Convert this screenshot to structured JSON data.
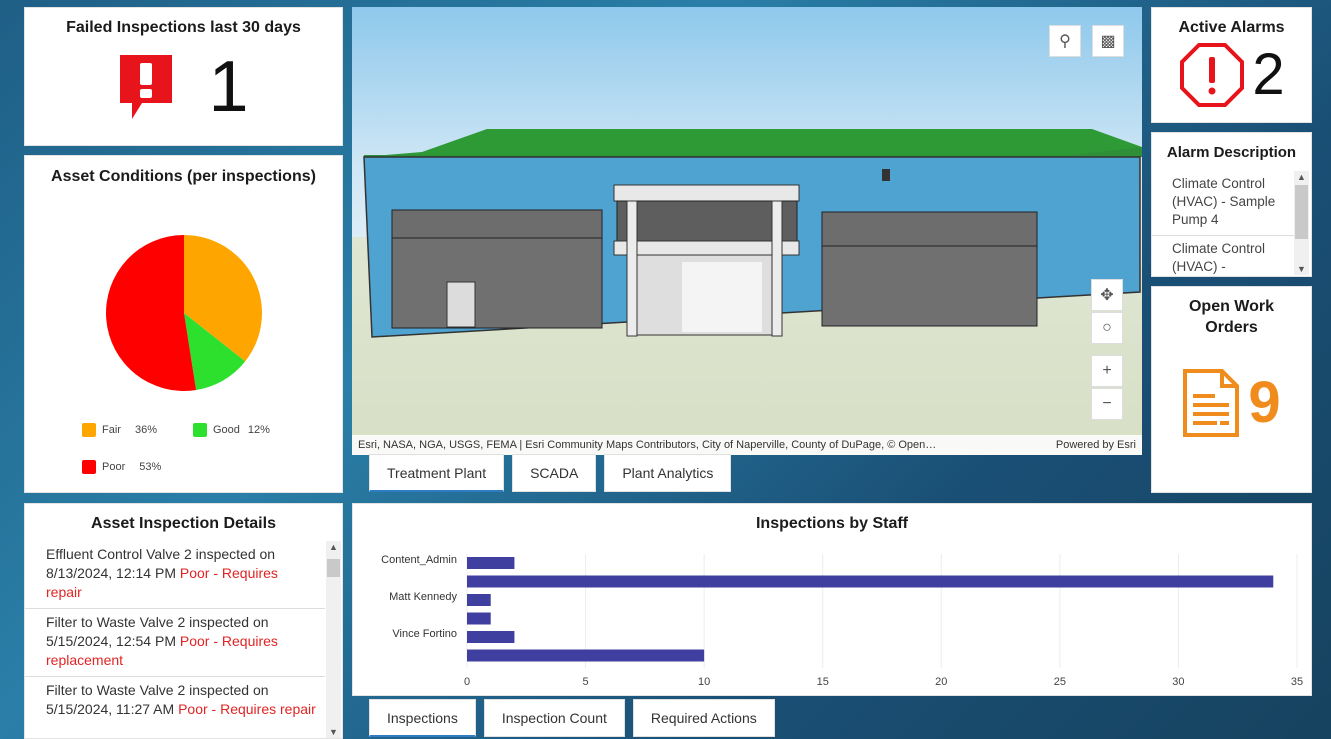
{
  "failed": {
    "title": "Failed Inspections last 30 days",
    "value": "1",
    "icon": "alert-comment-icon",
    "color": "#e8141b"
  },
  "conditions": {
    "title": "Asset Conditions (per inspections)",
    "legend": [
      {
        "label": "Fair",
        "pct": "36%",
        "color": "#ffa500"
      },
      {
        "label": "Good",
        "pct": "12%",
        "color": "#2ee02e"
      },
      {
        "label": "Poor",
        "pct": "53%",
        "color": "#ff0000"
      }
    ]
  },
  "scene": {
    "attribution": "Esri, NASA, NGA, USGS, FEMA | Esri Community Maps Contributors, City of Naperville, County of DuPage, © Open…",
    "powered_by": "Powered by Esri",
    "search_icon": "search-icon",
    "basemap_icon": "presentation-icon",
    "pan_icon": "pan-icon",
    "compass_icon": "compass-icon",
    "zoom_in": "+",
    "zoom_out": "−"
  },
  "scene_tabs": [
    {
      "label": "Treatment Plant",
      "active": true
    },
    {
      "label": "SCADA",
      "active": false
    },
    {
      "label": "Plant Analytics",
      "active": false
    }
  ],
  "alarms": {
    "title": "Active Alarms",
    "value": "2",
    "icon": "octagon-alert-icon",
    "color": "#e8141b"
  },
  "alarm_description": {
    "title": "Alarm Description",
    "items": [
      "Climate Control (HVAC) - Sample Pump 4",
      "Climate Control (HVAC) -"
    ]
  },
  "orders": {
    "title": "Open Work Orders",
    "value": "9",
    "icon": "document-icon",
    "color": "#f08c1e"
  },
  "details": {
    "title": "Asset Inspection Details",
    "items": [
      {
        "text": "Effluent Control Valve 2 inspected on 8/13/2024, 12:14 PM",
        "status": "Poor - Requires repair"
      },
      {
        "text": "Filter to Waste Valve 2 inspected on 5/15/2024, 12:54 PM",
        "status": "Poor - Requires replacement"
      },
      {
        "text": "Filter to Waste Valve 2 inspected on 5/15/2024, 11:27 AM",
        "status": "Poor - Requires repair"
      }
    ]
  },
  "staff_tabs": [
    {
      "label": "Inspections",
      "active": true
    },
    {
      "label": "Inspection Count",
      "active": false
    },
    {
      "label": "Required Actions",
      "active": false
    }
  ],
  "chart_data": {
    "type": "bar",
    "orientation": "horizontal",
    "title": "Inspections by Staff",
    "categories": [
      "Content_Admin",
      "",
      "Matt Kennedy",
      "",
      "Vince Fortino",
      ""
    ],
    "values": [
      2,
      34,
      1,
      1,
      2,
      10
    ],
    "xlim": [
      0,
      35
    ],
    "xticks": [
      0,
      5,
      10,
      15,
      20,
      25,
      30,
      35
    ],
    "color": "#3f3f9f",
    "grid": true
  }
}
